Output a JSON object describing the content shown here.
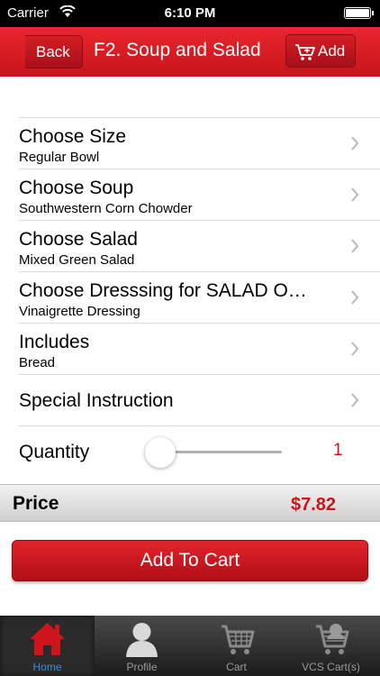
{
  "status_bar": {
    "carrier": "Carrier",
    "time": "6:10 PM"
  },
  "nav": {
    "back_label": "Back",
    "title": "F2. Soup and Salad",
    "add_label": "Add"
  },
  "options": [
    {
      "title": "Choose Size",
      "value": "Regular Bowl"
    },
    {
      "title": "Choose Soup",
      "value": "Southwestern Corn Chowder"
    },
    {
      "title": "Choose Salad",
      "value": "Mixed Green Salad"
    },
    {
      "title": "Choose Dresssing for SALAD O…",
      "value": "Vinaigrette Dressing"
    },
    {
      "title": "Includes",
      "value": "Bread"
    }
  ],
  "special_instruction": "Special Instruction",
  "quantity": {
    "label": "Quantity",
    "value": "1"
  },
  "price": {
    "label": "Price",
    "value": "$7.82"
  },
  "add_to_cart_label": "Add To Cart",
  "tabs": [
    {
      "label": "Home",
      "icon": "home-icon",
      "active": true
    },
    {
      "label": "Profile",
      "icon": "profile-icon",
      "active": false
    },
    {
      "label": "Cart",
      "icon": "cart-icon",
      "active": false
    },
    {
      "label": "VCS Cart(s)",
      "icon": "vcs-cart-icon",
      "active": false
    }
  ],
  "colors": {
    "accent": "#d0141b",
    "tab_active": "#3b8be0"
  }
}
